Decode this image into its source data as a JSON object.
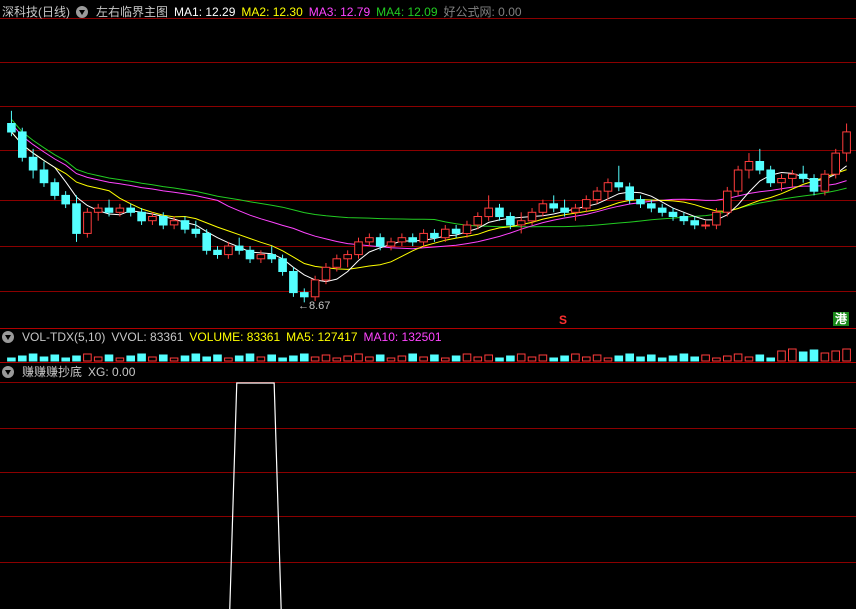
{
  "main_header": {
    "stock": "深科技(日线)",
    "indicator": "左右临界主图",
    "ma1": "MA1: 12.29",
    "ma2": "MA2: 12.30",
    "ma3": "MA3: 12.79",
    "ma4": "MA4: 12.09",
    "extra": "好公式网: 0.00"
  },
  "vol_header": {
    "name": "VOL-TDX(5,10)",
    "vvol": "VVOL: 83361",
    "volume": "VOLUME: 83361",
    "ma5": "MA5: 127417",
    "ma10": "MA10: 132501"
  },
  "sub_header": {
    "name": "赚赚赚抄底",
    "xg": "XG: 0.00"
  },
  "low_label": "8.67",
  "badges": {
    "s": "S",
    "gang": "港"
  },
  "colors": {
    "up": "#ff3c3c",
    "down": "#54ffff",
    "ma1": "#ffffff",
    "ma2": "#ffff00",
    "ma3": "#ff44ff",
    "ma4": "#22cc22",
    "grid": "#8b0000"
  },
  "chart_data": {
    "type": "candlestick",
    "price_range": [
      8.3,
      15.3
    ],
    "low_point": 8.67,
    "candles": [
      {
        "o": 12.9,
        "h": 13.2,
        "l": 12.6,
        "c": 12.7
      },
      {
        "o": 12.7,
        "h": 12.8,
        "l": 12.0,
        "c": 12.1
      },
      {
        "o": 12.1,
        "h": 12.3,
        "l": 11.6,
        "c": 11.8
      },
      {
        "o": 11.8,
        "h": 12.0,
        "l": 11.4,
        "c": 11.5
      },
      {
        "o": 11.5,
        "h": 11.6,
        "l": 11.1,
        "c": 11.2
      },
      {
        "o": 11.2,
        "h": 11.3,
        "l": 10.9,
        "c": 11.0
      },
      {
        "o": 11.0,
        "h": 11.2,
        "l": 10.1,
        "c": 10.3
      },
      {
        "o": 10.3,
        "h": 10.9,
        "l": 10.2,
        "c": 10.8
      },
      {
        "o": 10.8,
        "h": 11.0,
        "l": 10.6,
        "c": 10.9
      },
      {
        "o": 10.9,
        "h": 11.1,
        "l": 10.7,
        "c": 10.8
      },
      {
        "o": 10.8,
        "h": 11.0,
        "l": 10.7,
        "c": 10.9
      },
      {
        "o": 10.9,
        "h": 11.0,
        "l": 10.7,
        "c": 10.8
      },
      {
        "o": 10.8,
        "h": 10.9,
        "l": 10.5,
        "c": 10.6
      },
      {
        "o": 10.6,
        "h": 10.8,
        "l": 10.5,
        "c": 10.7
      },
      {
        "o": 10.7,
        "h": 10.8,
        "l": 10.4,
        "c": 10.5
      },
      {
        "o": 10.5,
        "h": 10.7,
        "l": 10.4,
        "c": 10.6
      },
      {
        "o": 10.6,
        "h": 10.7,
        "l": 10.3,
        "c": 10.4
      },
      {
        "o": 10.4,
        "h": 10.6,
        "l": 10.2,
        "c": 10.3
      },
      {
        "o": 10.3,
        "h": 10.4,
        "l": 9.8,
        "c": 9.9
      },
      {
        "o": 9.9,
        "h": 10.0,
        "l": 9.7,
        "c": 9.8
      },
      {
        "o": 9.8,
        "h": 10.1,
        "l": 9.7,
        "c": 10.0
      },
      {
        "o": 10.0,
        "h": 10.2,
        "l": 9.8,
        "c": 9.9
      },
      {
        "o": 9.9,
        "h": 10.0,
        "l": 9.6,
        "c": 9.7
      },
      {
        "o": 9.7,
        "h": 9.9,
        "l": 9.6,
        "c": 9.8
      },
      {
        "o": 9.8,
        "h": 10.0,
        "l": 9.6,
        "c": 9.7
      },
      {
        "o": 9.7,
        "h": 9.8,
        "l": 9.3,
        "c": 9.4
      },
      {
        "o": 9.4,
        "h": 9.5,
        "l": 8.8,
        "c": 8.9
      },
      {
        "o": 8.9,
        "h": 9.0,
        "l": 8.67,
        "c": 8.8
      },
      {
        "o": 8.8,
        "h": 9.3,
        "l": 8.7,
        "c": 9.2
      },
      {
        "o": 9.2,
        "h": 9.6,
        "l": 9.1,
        "c": 9.5
      },
      {
        "o": 9.5,
        "h": 9.8,
        "l": 9.4,
        "c": 9.7
      },
      {
        "o": 9.7,
        "h": 9.9,
        "l": 9.5,
        "c": 9.8
      },
      {
        "o": 9.8,
        "h": 10.2,
        "l": 9.7,
        "c": 10.1
      },
      {
        "o": 10.1,
        "h": 10.3,
        "l": 10.0,
        "c": 10.2
      },
      {
        "o": 10.2,
        "h": 10.3,
        "l": 9.9,
        "c": 10.0
      },
      {
        "o": 10.0,
        "h": 10.2,
        "l": 9.9,
        "c": 10.1
      },
      {
        "o": 10.1,
        "h": 10.3,
        "l": 10.0,
        "c": 10.2
      },
      {
        "o": 10.2,
        "h": 10.3,
        "l": 10.0,
        "c": 10.1
      },
      {
        "o": 10.1,
        "h": 10.4,
        "l": 10.0,
        "c": 10.3
      },
      {
        "o": 10.3,
        "h": 10.4,
        "l": 10.1,
        "c": 10.2
      },
      {
        "o": 10.2,
        "h": 10.5,
        "l": 10.1,
        "c": 10.4
      },
      {
        "o": 10.4,
        "h": 10.5,
        "l": 10.2,
        "c": 10.3
      },
      {
        "o": 10.3,
        "h": 10.6,
        "l": 10.2,
        "c": 10.5
      },
      {
        "o": 10.5,
        "h": 10.8,
        "l": 10.4,
        "c": 10.7
      },
      {
        "o": 10.7,
        "h": 11.2,
        "l": 10.6,
        "c": 10.9
      },
      {
        "o": 10.9,
        "h": 11.0,
        "l": 10.6,
        "c": 10.7
      },
      {
        "o": 10.7,
        "h": 10.8,
        "l": 10.4,
        "c": 10.5
      },
      {
        "o": 10.5,
        "h": 10.8,
        "l": 10.3,
        "c": 10.6
      },
      {
        "o": 10.6,
        "h": 10.9,
        "l": 10.5,
        "c": 10.8
      },
      {
        "o": 10.8,
        "h": 11.1,
        "l": 10.7,
        "c": 11.0
      },
      {
        "o": 11.0,
        "h": 11.2,
        "l": 10.8,
        "c": 10.9
      },
      {
        "o": 10.9,
        "h": 11.1,
        "l": 10.7,
        "c": 10.8
      },
      {
        "o": 10.8,
        "h": 11.0,
        "l": 10.6,
        "c": 10.9
      },
      {
        "o": 10.9,
        "h": 11.2,
        "l": 10.8,
        "c": 11.1
      },
      {
        "o": 11.1,
        "h": 11.4,
        "l": 11.0,
        "c": 11.3
      },
      {
        "o": 11.3,
        "h": 11.6,
        "l": 11.1,
        "c": 11.5
      },
      {
        "o": 11.5,
        "h": 11.9,
        "l": 11.3,
        "c": 11.4
      },
      {
        "o": 11.4,
        "h": 11.5,
        "l": 11.0,
        "c": 11.1
      },
      {
        "o": 11.1,
        "h": 11.2,
        "l": 10.9,
        "c": 11.0
      },
      {
        "o": 11.0,
        "h": 11.1,
        "l": 10.8,
        "c": 10.9
      },
      {
        "o": 10.9,
        "h": 11.0,
        "l": 10.7,
        "c": 10.8
      },
      {
        "o": 10.8,
        "h": 10.9,
        "l": 10.6,
        "c": 10.7
      },
      {
        "o": 10.7,
        "h": 10.8,
        "l": 10.5,
        "c": 10.6
      },
      {
        "o": 10.6,
        "h": 10.7,
        "l": 10.4,
        "c": 10.5
      },
      {
        "o": 10.5,
        "h": 10.6,
        "l": 10.4,
        "c": 10.5
      },
      {
        "o": 10.5,
        "h": 10.9,
        "l": 10.4,
        "c": 10.8
      },
      {
        "o": 10.8,
        "h": 11.4,
        "l": 10.7,
        "c": 11.3
      },
      {
        "o": 11.3,
        "h": 11.9,
        "l": 11.2,
        "c": 11.8
      },
      {
        "o": 11.8,
        "h": 12.2,
        "l": 11.6,
        "c": 12.0
      },
      {
        "o": 12.0,
        "h": 12.3,
        "l": 11.7,
        "c": 11.8
      },
      {
        "o": 11.8,
        "h": 11.9,
        "l": 11.4,
        "c": 11.5
      },
      {
        "o": 11.5,
        "h": 11.7,
        "l": 11.3,
        "c": 11.6
      },
      {
        "o": 11.6,
        "h": 11.8,
        "l": 11.4,
        "c": 11.7
      },
      {
        "o": 11.7,
        "h": 11.9,
        "l": 11.5,
        "c": 11.6
      },
      {
        "o": 11.6,
        "h": 11.7,
        "l": 11.2,
        "c": 11.3
      },
      {
        "o": 11.3,
        "h": 11.8,
        "l": 11.2,
        "c": 11.7
      },
      {
        "o": 11.7,
        "h": 12.3,
        "l": 11.6,
        "c": 12.2
      },
      {
        "o": 12.2,
        "h": 12.9,
        "l": 12.0,
        "c": 12.7
      }
    ],
    "sub_signal": {
      "start_index": 21,
      "end_index": 24,
      "level": 1
    }
  }
}
